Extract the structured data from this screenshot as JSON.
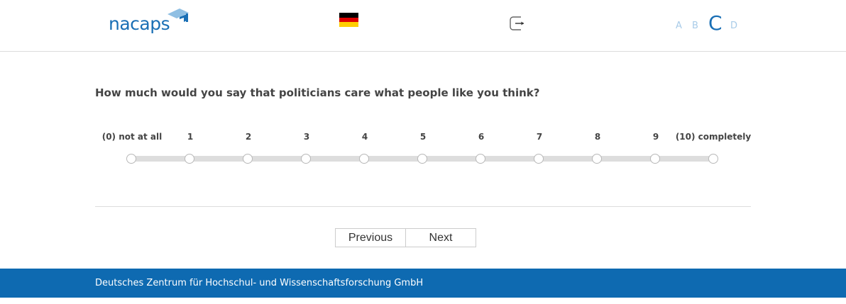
{
  "header": {
    "logo_text": "nacaps",
    "language_flag": "germany-flag",
    "logout_icon": "logout-icon",
    "font_sizes": [
      "A",
      "B",
      "C",
      "D"
    ],
    "active_font_size": "C",
    "colors": {
      "brand": "#1a6fb5",
      "inactive_font": "#a8cbe8"
    }
  },
  "question": {
    "text": "How much would you say that politicians care what people like you think?",
    "scale": [
      "(0) not at all",
      "1",
      "2",
      "3",
      "4",
      "5",
      "6",
      "7",
      "8",
      "9",
      "(10) completely"
    ],
    "selected": null
  },
  "navigation": {
    "previous_label": "Previous",
    "next_label": "Next"
  },
  "footer": {
    "text": "Deutsches Zentrum für Hochschul- und Wissenschaftsforschung GmbH",
    "background": "#0e6ab1"
  }
}
